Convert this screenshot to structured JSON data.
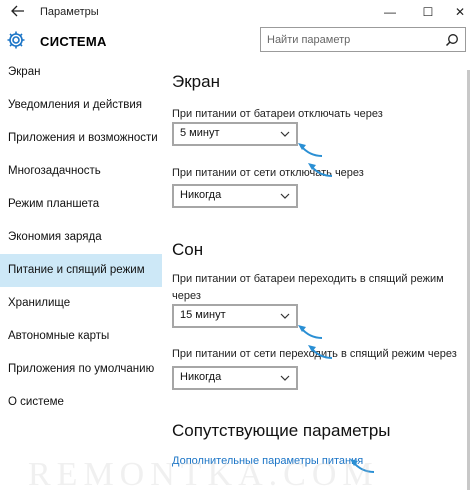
{
  "window": {
    "back_icon": "back-arrow-icon",
    "title": "Параметры",
    "controls": {
      "minimize": "—",
      "maximize": "☐",
      "close": "✕"
    }
  },
  "header": {
    "icon": "gear-icon",
    "title": "СИСТЕМА",
    "search_placeholder": "Найти параметр",
    "search_icon": "search-icon"
  },
  "sidebar": {
    "items": [
      {
        "label": "Экран"
      },
      {
        "label": "Уведомления и действия"
      },
      {
        "label": "Приложения и возможности"
      },
      {
        "label": "Многозадачность"
      },
      {
        "label": "Режим планшета"
      },
      {
        "label": "Экономия заряда"
      },
      {
        "label": "Питание и спящий режим",
        "active": true
      },
      {
        "label": "Хранилище"
      },
      {
        "label": "Автономные карты"
      },
      {
        "label": "Приложения по умолчанию"
      },
      {
        "label": "О системе"
      }
    ],
    "active_color": "#cde8f7"
  },
  "main": {
    "screen": {
      "heading": "Экран",
      "battery_label": "При питании от батареи отключать через",
      "battery_value": "5 минут",
      "ac_label": "При питании от сети отключать через",
      "ac_value": "Никогда"
    },
    "sleep": {
      "heading": "Сон",
      "battery_label": "При питании от батареи переходить в спящий режим через",
      "battery_value": "15 минут",
      "ac_label": "При питании от сети переходить в спящий режим через",
      "ac_value": "Никогда"
    },
    "related": {
      "heading": "Сопутствующие параметры",
      "link": "Дополнительные параметры питания"
    }
  },
  "watermark": "REMONTKA.COM",
  "colors": {
    "accent": "#1a74c6",
    "annotation_arrow": "#2a8fd4",
    "select_border": "#a6a6a6"
  }
}
